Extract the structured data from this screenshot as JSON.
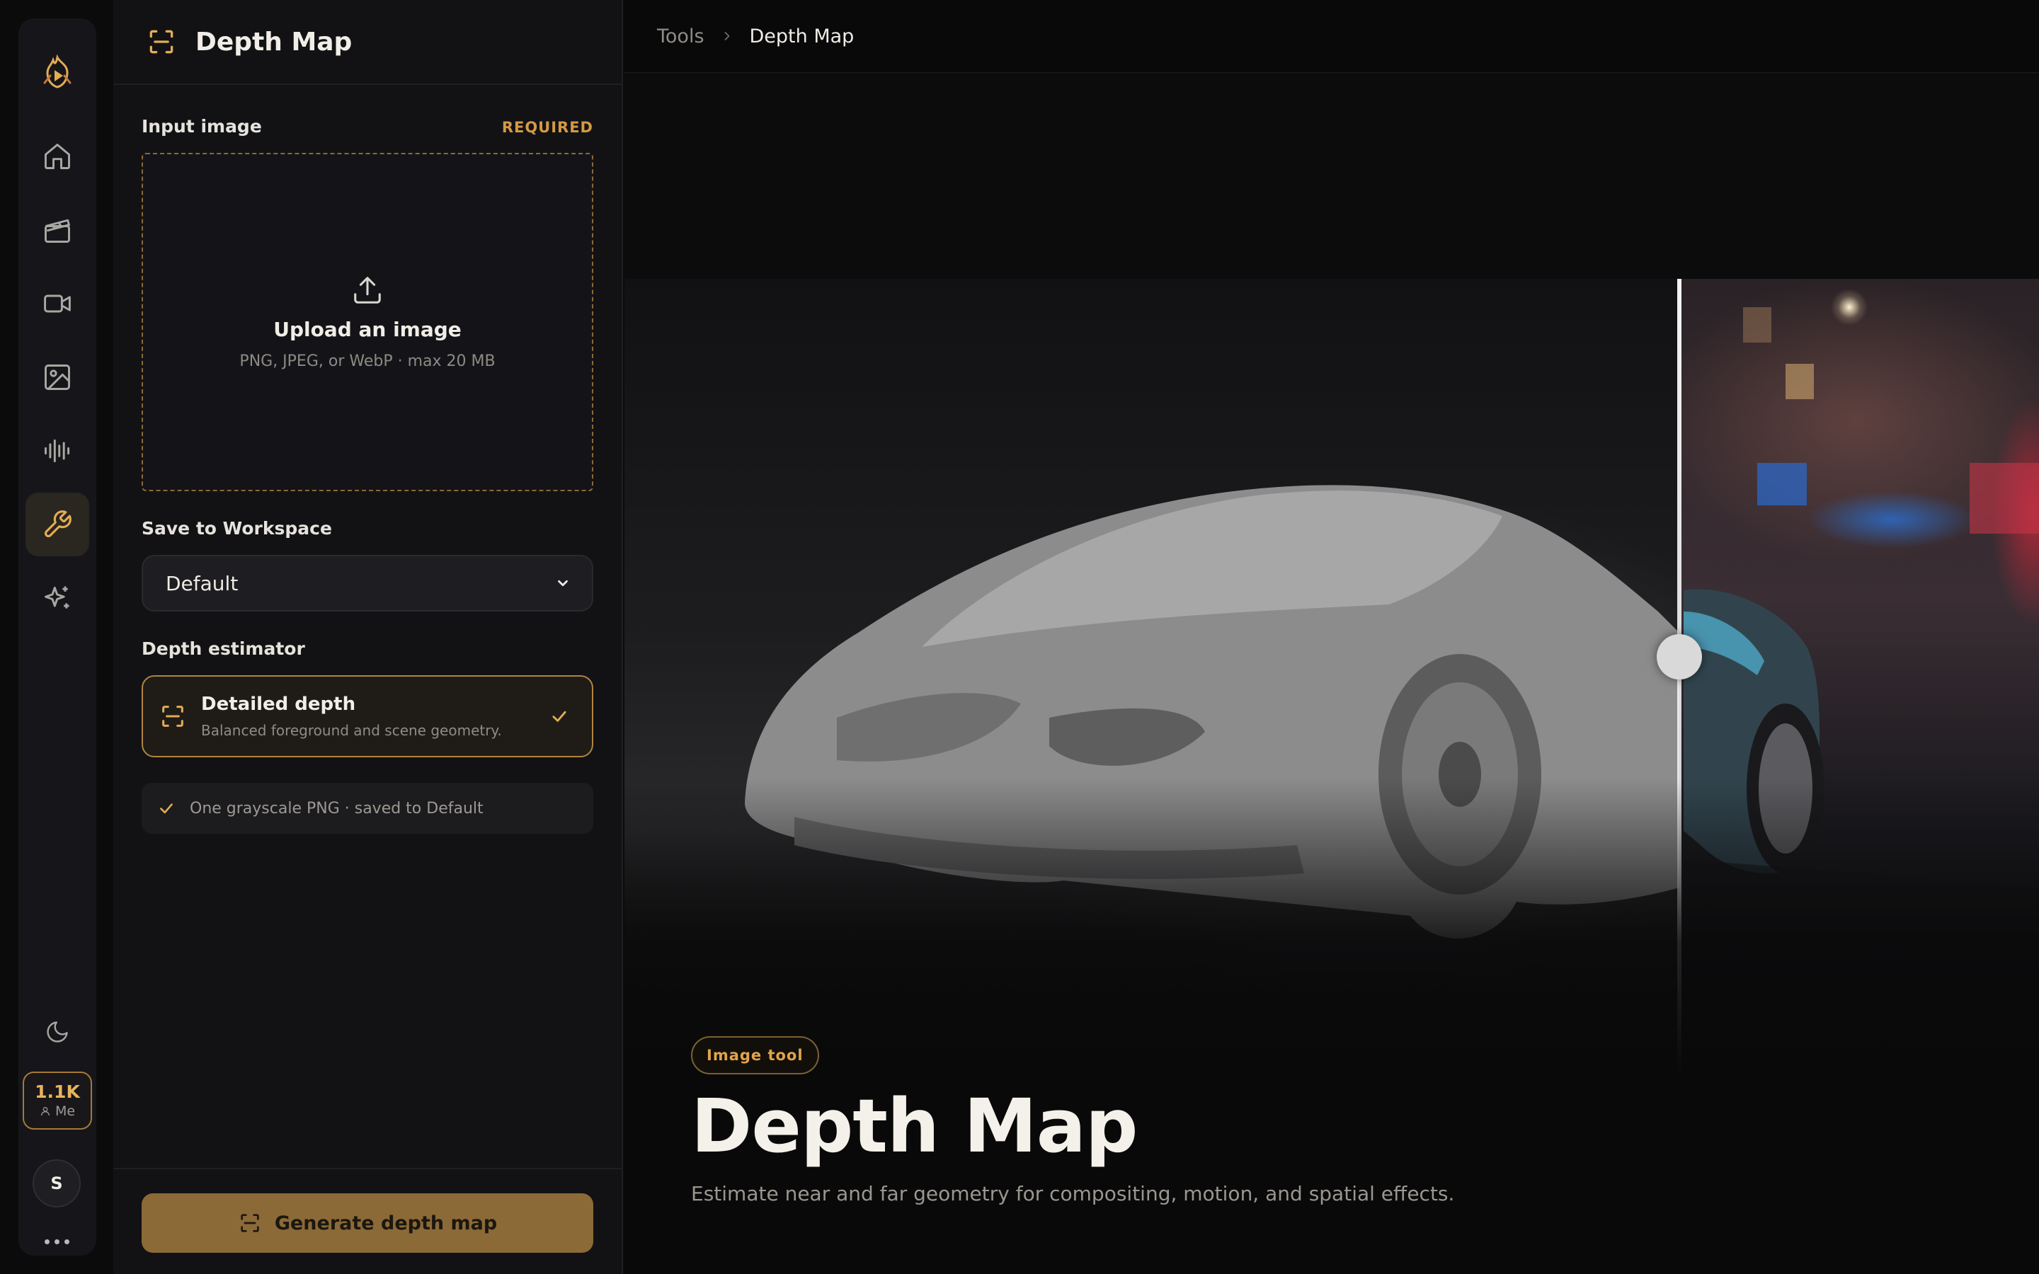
{
  "rail": {
    "items": [
      {
        "name": "home"
      },
      {
        "name": "clapperboard"
      },
      {
        "name": "video"
      },
      {
        "name": "image"
      },
      {
        "name": "audio-waveform"
      },
      {
        "name": "tools",
        "active": true
      },
      {
        "name": "sparkles"
      }
    ],
    "credits": {
      "value": "1.1K",
      "user_label": "Me"
    },
    "avatar_initial": "S"
  },
  "panel": {
    "title": "Depth Map",
    "input_image": {
      "label": "Input image",
      "required_tag": "REQUIRED",
      "upload_title": "Upload an image",
      "upload_hint": "PNG, JPEG, or WebP · max 20 MB"
    },
    "workspace": {
      "label": "Save to Workspace",
      "selected": "Default"
    },
    "estimator": {
      "label": "Depth estimator",
      "option_title": "Detailed depth",
      "option_desc": "Balanced foreground and scene geometry.",
      "selected": true
    },
    "note": "One grayscale PNG · saved to Default",
    "generate_label": "Generate depth map"
  },
  "main": {
    "breadcrumb": {
      "parent": "Tools",
      "current": "Depth Map"
    },
    "badge": "Image tool",
    "title": "Depth Map",
    "subtitle": "Estimate near and far geometry for compositing, motion, and spatial effects."
  },
  "colors": {
    "accent": "#e2ac56",
    "accent_border": "#b1853e",
    "button_bg": "#8b6a38",
    "panel_bg": "#121215",
    "page_bg": "#09090a"
  }
}
